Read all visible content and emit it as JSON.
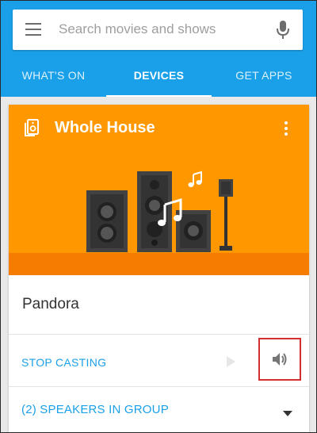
{
  "search": {
    "placeholder": "Search movies and shows"
  },
  "tabs": [
    {
      "label": "WHAT'S ON",
      "active": false
    },
    {
      "label": "DEVICES",
      "active": true
    },
    {
      "label": "GET APPS",
      "active": false
    }
  ],
  "device_card": {
    "group_name": "Whole House",
    "now_playing": "Pandora",
    "stop_casting_label": "STOP CASTING",
    "speakers_in_group_label": "(2) SPEAKERS IN GROUP"
  },
  "icons": {
    "menu": "hamburger-menu-icon",
    "mic": "microphone-icon",
    "group": "speaker-group-icon",
    "more": "more-vertical-icon",
    "play": "play-icon",
    "volume": "volume-icon",
    "expand": "caret-down-icon"
  },
  "colors": {
    "app_bar": "#1aa0e8",
    "hero": "#ff9800",
    "hero_band": "#f57c00",
    "accent_text": "#1aa0e8",
    "highlight_box": "#d32f2f"
  }
}
